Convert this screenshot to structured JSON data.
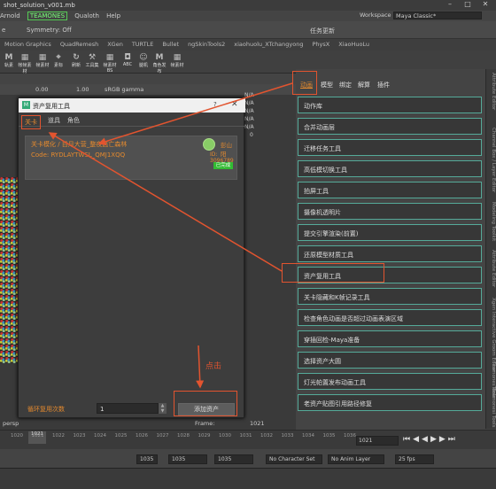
{
  "window": {
    "title": "shot_solution_v001.mb",
    "controls": [
      "–",
      "□",
      "✕"
    ]
  },
  "menu": {
    "items": [
      "Arnold",
      "TEAMONES",
      "Qualoth",
      "Help"
    ],
    "workspace_label": "Workspace :",
    "workspace_value": "Maya Classic*"
  },
  "statusline": {
    "prefix": "e",
    "symmetry": "Symmetry: Off",
    "task_update": "任务更新"
  },
  "shelf_tabs": [
    "Motion Graphics",
    "QuadRemesh",
    "XGen",
    "TURTLE",
    "Bullet",
    "ngSkinTools2",
    "xiaohuolu_XTchangyong",
    "PhysX",
    "XiaoHuoLu"
  ],
  "shelf_buttons": [
    "轨素",
    "帐帧素材",
    "帧素材",
    "素标",
    "刷新",
    "工具集",
    "帧素材BS",
    "ABC",
    "腿机",
    "角色发布",
    "帧素材"
  ],
  "viewport": {
    "val1": "0.00",
    "val2": "1.00",
    "colorspace": "sRGB gamma",
    "camera": "persp",
    "frame_label": "Frame:",
    "frame_value": "1021",
    "channels": [
      "N/A",
      "N/A",
      "N/A",
      "N/A",
      "N/A",
      "0"
    ]
  },
  "dialog": {
    "title": "资产复用工具",
    "help": "?",
    "close": "✕",
    "tabs": [
      "关卡",
      "道具",
      "角色"
    ],
    "card": {
      "title": "关卡模化 / 目月大营_整夜逃亡森林",
      "code": "Code: RYDLAYTWSL_QMJ1XQQ",
      "owner": "彭山阳",
      "id": "ID: 3096789",
      "status": "已完成"
    },
    "loop_label": "循环复用次数",
    "loop_value": "1",
    "add_button": "添加资产"
  },
  "annotation": "点击",
  "right_panel": {
    "tabs": [
      "动画",
      "模型",
      "绑定",
      "解算",
      "插件"
    ],
    "buttons": [
      "动作库",
      "合并动画层",
      "迁移任务工具",
      "高低模切换工具",
      "拍屏工具",
      "摄像机透明片",
      "提交引擎渲染(前置)",
      "还原模型材质工具",
      "资产复用工具",
      "关卡隐藏和K帧记录工具",
      "检查角色动画是否超过动画表演区域",
      "穿插回检-Maya准备",
      "选择资产大圆",
      "灯光帕置发布动画工具",
      "老资产贴图引用路径修复"
    ]
  },
  "side_tabs": [
    "Attribute Editor",
    "Channel Box / Layer Editor",
    "Modeling Toolkit",
    "Attribute Editor",
    "Xgen Interactive Groom Editor",
    "TeamonesTools",
    "Teamonesi Tools"
  ],
  "timeline": {
    "ticks": [
      "1020",
      "1021",
      "1022",
      "1023",
      "1024",
      "1025",
      "1026",
      "1027",
      "1028",
      "1029",
      "1030",
      "1031",
      "1032",
      "1033",
      "1034",
      "1035",
      "1036"
    ],
    "current": "1021",
    "frame_box": "1021"
  },
  "range": {
    "start": "1035",
    "end1": "1035",
    "end2": "1035",
    "character_set": "No Character Set",
    "anim_layer": "No Anim Layer",
    "fps": "25 fps"
  }
}
